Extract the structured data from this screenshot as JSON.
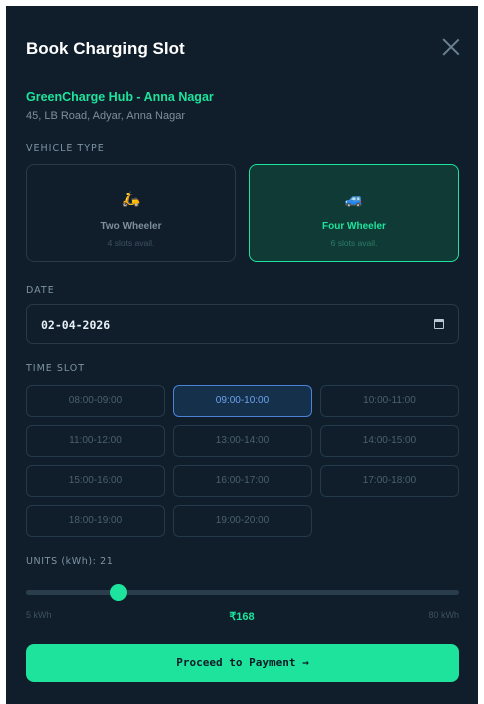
{
  "modal": {
    "title": "Book Charging Slot"
  },
  "station": {
    "name": "GreenCharge Hub - Anna Nagar",
    "address": "45, LB Road, Adyar, Anna Nagar"
  },
  "vehicle_type": {
    "label": "VEHICLE TYPE",
    "options": [
      {
        "icon": "scooter-icon",
        "glyph": "🛵",
        "name": "Two Wheeler",
        "slots": "4 slots avail.",
        "selected": false
      },
      {
        "icon": "car-icon",
        "glyph": "🚙",
        "name": "Four Wheeler",
        "slots": "6 slots avail.",
        "selected": true
      }
    ]
  },
  "date": {
    "label": "DATE",
    "value": "02-04-2026",
    "icon": "calendar-icon"
  },
  "time_slot": {
    "label": "TIME SLOT",
    "selected": "09:00-10:00",
    "slots": [
      "08:00-09:00",
      "09:00-10:00",
      "10:00-11:00",
      "11:00-12:00",
      "13:00-14:00",
      "14:00-15:00",
      "15:00-16:00",
      "16:00-17:00",
      "17:00-18:00",
      "18:00-19:00",
      "19:00-20:00"
    ]
  },
  "units": {
    "label": "UNITS (kWh): 21",
    "value": 21,
    "min": 5,
    "max": 80,
    "min_label": "5 kWh",
    "max_label": "80 kWh",
    "price": "₹168"
  },
  "actions": {
    "proceed_label": "Proceed to Payment →"
  },
  "colors": {
    "accent": "#1ee39c",
    "background": "#0f1e2a",
    "selected_slot": "#4c82d8"
  }
}
